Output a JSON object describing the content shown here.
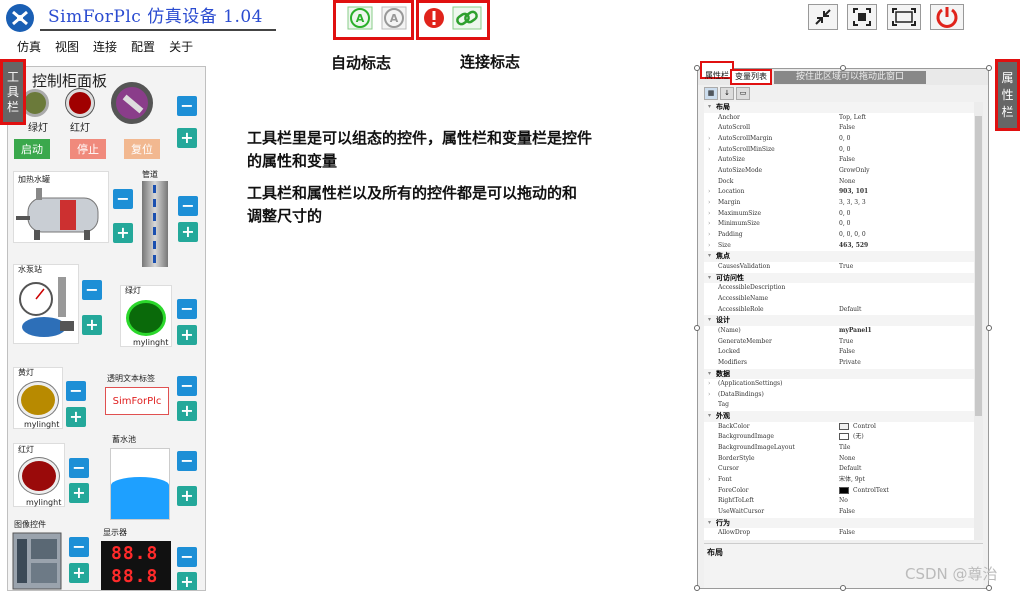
{
  "app": {
    "title": "SimForPlc 仿真设备 1.04"
  },
  "annotations": {
    "auto_flag": "自动标志",
    "connect_flag": "连接标志"
  },
  "menu": [
    "仿真",
    "视图",
    "连接",
    "配置",
    "关于"
  ],
  "left_panel": {
    "title": "控制柜面板",
    "sidebar_tab": [
      "工",
      "具",
      "栏"
    ],
    "lamps": {
      "green": "绿灯",
      "red": "红灯"
    },
    "buttons": {
      "start": "启动",
      "stop": "停止",
      "reset": "复位"
    },
    "widgets": {
      "tank": "加热水罐",
      "pipe": "管道",
      "pump": "水泵站",
      "green_lamp": "绿灯",
      "green_lamp_name": "mylinght",
      "yellow_lamp": "黄灯",
      "yellow_lamp_name": "mylinght",
      "text_label": "透明文本标签",
      "text_label_value": "SimForPlc",
      "red_lamp": "红灯",
      "red_lamp_name": "mylinght",
      "reservoir": "蓄水池",
      "image_ctrl": "图像控件",
      "display": "显示器",
      "display_value": "88.8"
    },
    "colors": {
      "start": "#3aa84c",
      "stop": "#f08a7c",
      "reset": "#f2b890"
    }
  },
  "description": {
    "line1": "工具栏里是可以组态的控件，属性栏和变量栏是控件",
    "line2": "的属性和变量",
    "line3": "工具栏和属性栏以及所有的控件都是可以拖动的和",
    "line4": "调整尺寸的"
  },
  "prop_panel": {
    "tab_props": "属性栏",
    "tab_vars": "变量列表",
    "drag_hint": "按住此区域可以拖动此窗口",
    "rows": [
      {
        "type": "cat",
        "name": "布局"
      },
      {
        "name": "Anchor",
        "value": "Top, Left"
      },
      {
        "name": "AutoScroll",
        "value": "False"
      },
      {
        "name": "AutoScrollMargin",
        "value": "0, 0",
        "exp": true
      },
      {
        "name": "AutoScrollMinSize",
        "value": "0, 0",
        "exp": true
      },
      {
        "name": "AutoSize",
        "value": "False"
      },
      {
        "name": "AutoSizeMode",
        "value": "GrowOnly"
      },
      {
        "name": "Dock",
        "value": "None"
      },
      {
        "name": "Location",
        "value": "903, 101",
        "exp": true,
        "bold": true
      },
      {
        "name": "Margin",
        "value": "3, 3, 3, 3",
        "exp": true
      },
      {
        "name": "MaximumSize",
        "value": "0, 0",
        "exp": true
      },
      {
        "name": "MinimumSize",
        "value": "0, 0",
        "exp": true
      },
      {
        "name": "Padding",
        "value": "0, 0, 0, 0",
        "exp": true
      },
      {
        "name": "Size",
        "value": "463, 529",
        "exp": true,
        "bold": true
      },
      {
        "type": "cat",
        "name": "焦点"
      },
      {
        "name": "CausesValidation",
        "value": "True"
      },
      {
        "type": "cat",
        "name": "可访问性"
      },
      {
        "name": "AccessibleDescription",
        "value": ""
      },
      {
        "name": "AccessibleName",
        "value": ""
      },
      {
        "name": "AccessibleRole",
        "value": "Default"
      },
      {
        "type": "cat",
        "name": "设计"
      },
      {
        "name": "(Name)",
        "value": "myPanel1",
        "bold": true
      },
      {
        "name": "GenerateMember",
        "value": "True"
      },
      {
        "name": "Locked",
        "value": "False"
      },
      {
        "name": "Modifiers",
        "value": "Private"
      },
      {
        "type": "cat",
        "name": "数据"
      },
      {
        "name": "(ApplicationSettings)",
        "value": "",
        "exp": true
      },
      {
        "name": "(DataBindings)",
        "value": "",
        "exp": true
      },
      {
        "name": "Tag",
        "value": ""
      },
      {
        "type": "cat",
        "name": "外观"
      },
      {
        "name": "BackColor",
        "value": "Control",
        "swatch": "#f0f0f0"
      },
      {
        "name": "BackgroundImage",
        "value": "(无)",
        "swatch": "#ffffff"
      },
      {
        "name": "BackgroundImageLayout",
        "value": "Tile"
      },
      {
        "name": "BorderStyle",
        "value": "None"
      },
      {
        "name": "Cursor",
        "value": "Default"
      },
      {
        "name": "Font",
        "value": "宋体, 9pt",
        "exp": true
      },
      {
        "name": "ForeColor",
        "value": "ControlText",
        "swatch": "#000000"
      },
      {
        "name": "RightToLeft",
        "value": "No"
      },
      {
        "name": "UseWaitCursor",
        "value": "False"
      },
      {
        "type": "cat",
        "name": "行为"
      },
      {
        "name": "AllowDrop",
        "value": "False"
      }
    ],
    "desc_title": "布局"
  },
  "attr_tab": [
    "属",
    "性",
    "栏"
  ],
  "watermark": "CSDN @尊治"
}
